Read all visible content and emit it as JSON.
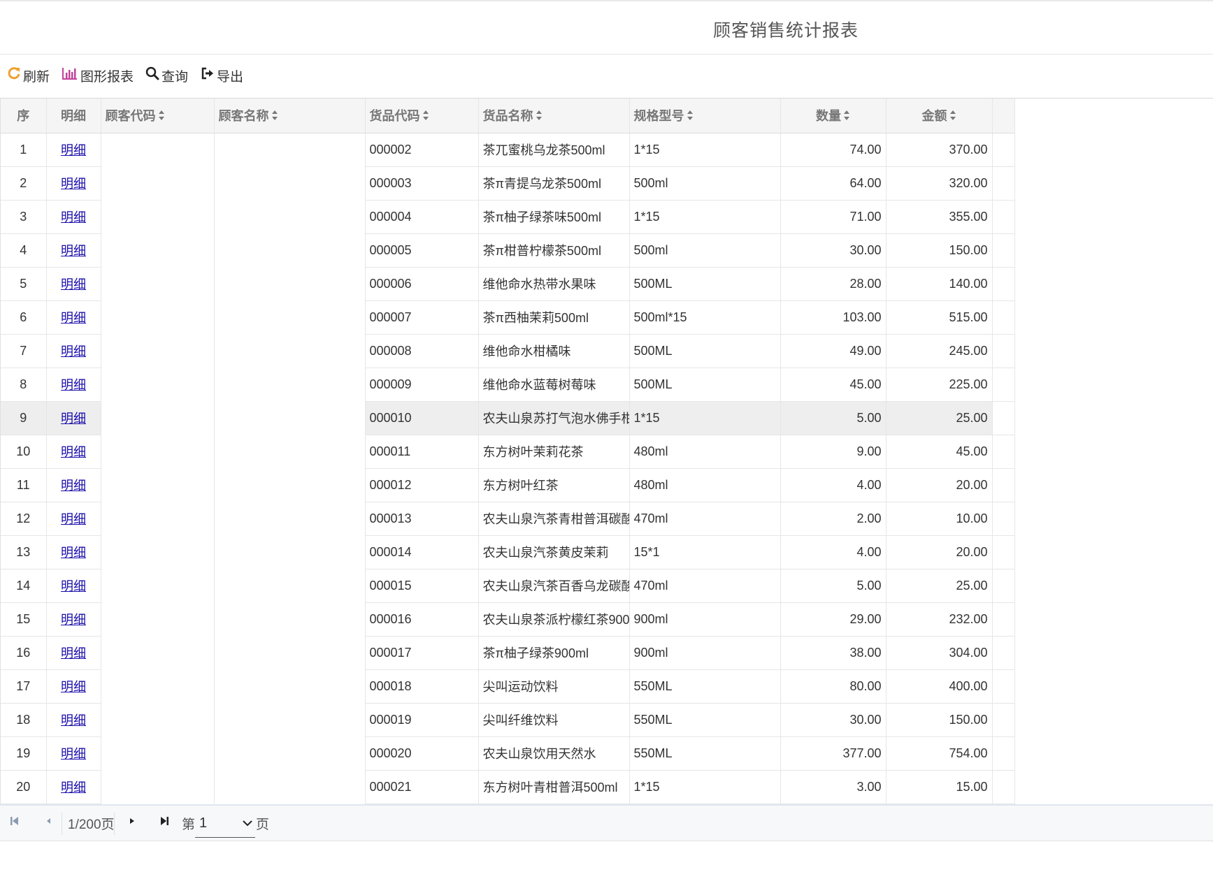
{
  "header": {
    "title": "顾客销售统计报表"
  },
  "toolbar": {
    "refresh": "刷新",
    "chart": "图形报表",
    "query": "查询",
    "export": "导出",
    "colors": {
      "refresh_icon": "#f0a030",
      "chart_icon": "#c0449a",
      "query_icon": "#222222",
      "export_icon": "#222222"
    }
  },
  "table": {
    "columns": [
      "序",
      "明细",
      "顾客代码",
      "顾客名称",
      "货品代码",
      "货品名称",
      "规格型号",
      "数量",
      "金额"
    ],
    "detail_link": "明细",
    "rows": [
      {
        "seq": "1",
        "code": "000002",
        "name": "茶兀蜜桃乌龙茶500ml",
        "spec": "1*15",
        "qty": "74.00",
        "amount": "370.00"
      },
      {
        "seq": "2",
        "code": "000003",
        "name": "茶π青提乌龙茶500ml",
        "spec": "500ml",
        "qty": "64.00",
        "amount": "320.00"
      },
      {
        "seq": "3",
        "code": "000004",
        "name": "茶π柚子绿茶味500ml",
        "spec": "1*15",
        "qty": "71.00",
        "amount": "355.00"
      },
      {
        "seq": "4",
        "code": "000005",
        "name": "茶π柑普柠檬茶500ml",
        "spec": "500ml",
        "qty": "30.00",
        "amount": "150.00"
      },
      {
        "seq": "5",
        "code": "000006",
        "name": "维他命水热带水果味",
        "spec": "500ML",
        "qty": "28.00",
        "amount": "140.00"
      },
      {
        "seq": "6",
        "code": "000007",
        "name": "茶π西柚茉莉500ml",
        "spec": "500ml*15",
        "qty": "103.00",
        "amount": "515.00"
      },
      {
        "seq": "7",
        "code": "000008",
        "name": "维他命水柑橘味",
        "spec": "500ML",
        "qty": "49.00",
        "amount": "245.00"
      },
      {
        "seq": "8",
        "code": "000009",
        "name": "维他命水蓝莓树莓味",
        "spec": "500ML",
        "qty": "45.00",
        "amount": "225.00"
      },
      {
        "seq": "9",
        "code": "000010",
        "name": "农夫山泉苏打气泡水佛手柑",
        "spec": "1*15",
        "qty": "5.00",
        "amount": "25.00"
      },
      {
        "seq": "10",
        "code": "000011",
        "name": "东方树叶茉莉花茶",
        "spec": "480ml",
        "qty": "9.00",
        "amount": "45.00"
      },
      {
        "seq": "11",
        "code": "000012",
        "name": "东方树叶红茶",
        "spec": "480ml",
        "qty": "4.00",
        "amount": "20.00"
      },
      {
        "seq": "12",
        "code": "000013",
        "name": "农夫山泉汽茶青柑普洱碳酸",
        "spec": "470ml",
        "qty": "2.00",
        "amount": "10.00"
      },
      {
        "seq": "13",
        "code": "000014",
        "name": "农夫山泉汽茶黄皮茉莉",
        "spec": "15*1",
        "qty": "4.00",
        "amount": "20.00"
      },
      {
        "seq": "14",
        "code": "000015",
        "name": "农夫山泉汽茶百香乌龙碳酸",
        "spec": "470ml",
        "qty": "5.00",
        "amount": "25.00"
      },
      {
        "seq": "15",
        "code": "000016",
        "name": "农夫山泉茶派柠檬红茶900",
        "spec": "900ml",
        "qty": "29.00",
        "amount": "232.00"
      },
      {
        "seq": "16",
        "code": "000017",
        "name": "茶π柚子绿茶900ml",
        "spec": "900ml",
        "qty": "38.00",
        "amount": "304.00"
      },
      {
        "seq": "17",
        "code": "000018",
        "name": "尖叫运动饮料",
        "spec": "550ML",
        "qty": "80.00",
        "amount": "400.00"
      },
      {
        "seq": "18",
        "code": "000019",
        "name": "尖叫纤维饮料",
        "spec": "550ML",
        "qty": "30.00",
        "amount": "150.00"
      },
      {
        "seq": "19",
        "code": "000020",
        "name": "农夫山泉饮用天然水",
        "spec": "550ML",
        "qty": "377.00",
        "amount": "754.00"
      },
      {
        "seq": "20",
        "code": "000021",
        "name": "东方树叶青柑普洱500ml",
        "spec": "1*15",
        "qty": "3.00",
        "amount": "15.00"
      }
    ]
  },
  "pager": {
    "info": "1/200页",
    "prefix": "第",
    "current": "1",
    "suffix": "页"
  }
}
